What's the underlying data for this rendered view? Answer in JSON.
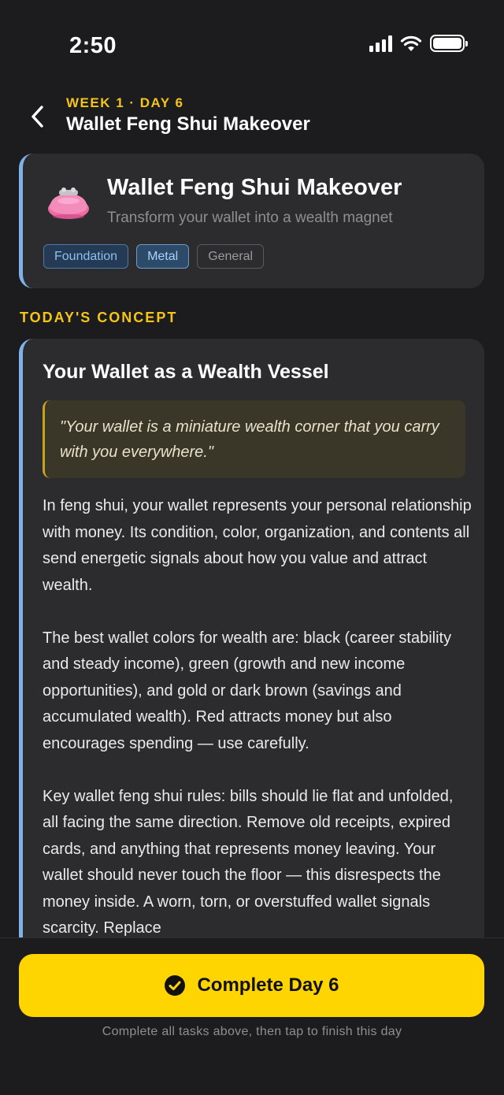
{
  "status_bar": {
    "time": "2:50"
  },
  "header": {
    "eyebrow": "WEEK 1 · DAY 6",
    "title": "Wallet Feng Shui Makeover"
  },
  "lesson": {
    "icon": "purse-icon",
    "title": "Wallet Feng Shui Makeover",
    "subtitle": "Transform your wallet into a wealth magnet",
    "tags": [
      "Foundation",
      "Metal",
      "General"
    ]
  },
  "section": {
    "label": "TODAY'S CONCEPT"
  },
  "concept": {
    "title": "Your Wallet as a Wealth Vessel",
    "quote": "\"Your wallet is a miniature wealth corner that you carry with you everywhere.\"",
    "paragraphs": [
      "In feng shui, your wallet represents your personal relationship with money. Its condition, color, organization, and contents all send energetic signals about how you value and attract wealth.",
      "The best wallet colors for wealth are: black (career stability and steady income), green (growth and new income opportunities), and gold or dark brown (savings and accumulated wealth). Red attracts money but also encourages spending — use carefully.",
      "Key wallet feng shui rules: bills should lie flat and unfolded, all facing the same direction. Remove old receipts, expired cards, and anything that represents money leaving. Your wallet should never touch the floor — this disrespects the money inside. A worn, torn, or overstuffed wallet signals scarcity. Replace"
    ]
  },
  "footer": {
    "button_label": "Complete Day 6",
    "hint": "Complete all tasks above, then tap to finish this day"
  },
  "colors": {
    "accent_yellow": "#ffd500",
    "eyebrow_yellow": "#f5c518",
    "card_accent_blue": "#7fb3e8",
    "background": "#1c1c1e",
    "card": "#2c2c2e"
  }
}
